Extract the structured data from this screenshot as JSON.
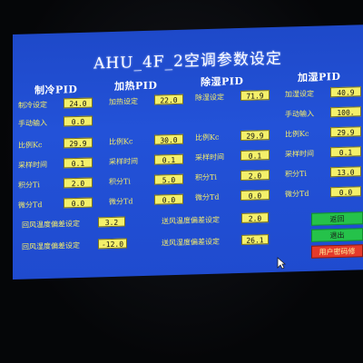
{
  "title": "AHU_4F_2空调参数设定",
  "cooling": {
    "header": "制冷PID",
    "setpoint_label": "制冷设定",
    "setpoint_value": "24.0",
    "manual_label": "手动输入",
    "manual_value": "0.0",
    "kc_label": "比例Kc",
    "kc_value": "29.9",
    "sample_label": "采样时间",
    "sample_value": "0.1",
    "ti_label": "积分Ti",
    "ti_value": "2.0",
    "td_label": "微分Td",
    "td_value": "0.0"
  },
  "heating": {
    "header": "加热PID",
    "setpoint_label": "加热设定",
    "setpoint_value": "22.0",
    "kc_label": "比例Kc",
    "kc_value": "30.0",
    "sample_label": "采样时间",
    "sample_value": "0.1",
    "ti_label": "积分Ti",
    "ti_value": "5.0",
    "td_label": "微分Td",
    "td_value": "0.0"
  },
  "dehumid": {
    "header": "除湿PID",
    "setpoint_label": "除湿设定",
    "setpoint_value": "71.9",
    "kc_label": "比例Kc",
    "kc_value": "29.9",
    "sample_label": "采样时间",
    "sample_value": "0.1",
    "ti_label": "积分Ti",
    "ti_value": "2.0",
    "td_label": "微分Td",
    "td_value": "0.0"
  },
  "humid": {
    "header": "加湿PID",
    "setpoint_label": "加湿设定",
    "setpoint_value": "40.9",
    "manual_label": "手动输入",
    "manual_value": "100.",
    "kc_label": "比例Kc",
    "kc_value": "29.9",
    "sample_label": "采样时间",
    "sample_value": "0.1",
    "ti_label": "积分Ti",
    "ti_value": "13.0",
    "td_label": "微分Td",
    "td_value": "0.0"
  },
  "offsets": {
    "return_temp_label": "回风温度偏差设定",
    "return_temp_value": "3.2",
    "return_humid_label": "回风湿度偏差设定",
    "return_humid_value": "-12.0",
    "supply_temp_label": "送风温度偏差设定",
    "supply_temp_value": "2.0",
    "supply_humid_label": "送风湿度偏差设定",
    "supply_humid_value": "26.1"
  },
  "buttons": {
    "back_label": "返回",
    "exit_label": "退出",
    "password_label": "用户密码修"
  },
  "colors": {
    "screen_blue": "#2352d8",
    "label_yellow": "#f6ee6a",
    "field_yellow": "#f4f06a",
    "button_green": "#25c24a",
    "button_red": "#e43a2b"
  },
  "icons": {
    "cursor": "mouse-pointer-icon"
  }
}
